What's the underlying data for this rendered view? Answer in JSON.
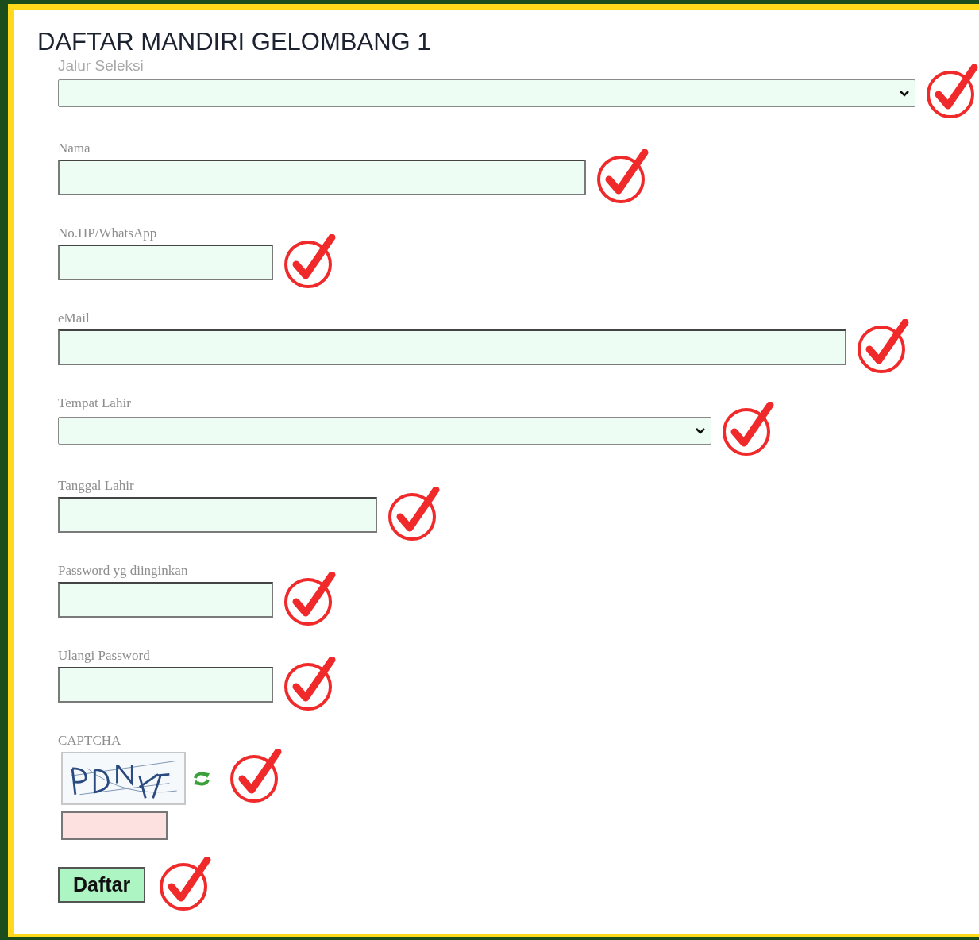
{
  "title": "DAFTAR MANDIRI GELOMBANG 1",
  "fields": [
    {
      "label": "Jalur Seleksi",
      "kind": "select",
      "marked": true
    },
    {
      "label": "Nama",
      "kind": "text",
      "marked": true
    },
    {
      "label": "No.HP/WhatsApp",
      "kind": "text",
      "marked": true
    },
    {
      "label": "eMail",
      "kind": "text",
      "marked": true
    },
    {
      "label": "Tempat Lahir",
      "kind": "select",
      "marked": true
    },
    {
      "label": "Tanggal Lahir",
      "kind": "text",
      "marked": true
    },
    {
      "label": "Password yg diinginkan",
      "kind": "password",
      "marked": true
    },
    {
      "label": "Ulangi Password",
      "kind": "password",
      "marked": true
    }
  ],
  "captcha": {
    "label": "CAPTCHA",
    "marked": true
  },
  "submit": {
    "label": "Daftar",
    "marked": true
  }
}
